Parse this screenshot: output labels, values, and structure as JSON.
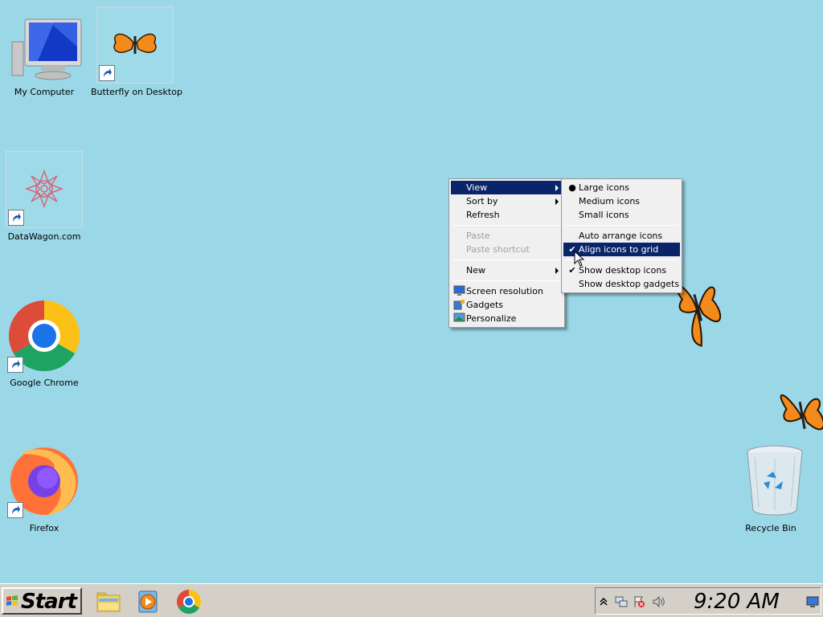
{
  "desktop": {
    "background": "#9ad8e8",
    "icons": [
      {
        "label": "My Computer",
        "icon": "monitor-icon",
        "shortcut": false
      },
      {
        "label": "Butterfly on Desktop",
        "icon": "butterfly-icon",
        "shortcut": true
      },
      {
        "label": "DataWagon.com",
        "icon": "datawagon-icon",
        "shortcut": true
      },
      {
        "label": "Google Chrome",
        "icon": "chrome-icon",
        "shortcut": true
      },
      {
        "label": "Firefox",
        "icon": "firefox-icon",
        "shortcut": true
      },
      {
        "label": "Recycle Bin",
        "icon": "recycle-bin-icon",
        "shortcut": false
      }
    ]
  },
  "context_menu": {
    "items": [
      {
        "label": "View",
        "highlighted": true,
        "submenu": true
      },
      {
        "label": "Sort by",
        "submenu": true
      },
      {
        "label": "Refresh"
      },
      {
        "label": "Paste",
        "disabled": true
      },
      {
        "label": "Paste shortcut",
        "disabled": true
      },
      {
        "label": "New",
        "submenu": true
      },
      {
        "label": "Screen resolution",
        "icon": "screen-resolution-icon"
      },
      {
        "label": "Gadgets",
        "icon": "gadgets-icon"
      },
      {
        "label": "Personalize",
        "icon": "personalize-icon"
      }
    ]
  },
  "view_submenu": {
    "items": [
      {
        "label": "Large icons",
        "mark": "bullet"
      },
      {
        "label": "Medium icons"
      },
      {
        "label": "Small icons"
      },
      {
        "label": "Auto arrange icons"
      },
      {
        "label": "Align icons to grid",
        "mark": "check",
        "highlighted": true
      },
      {
        "label": "Show desktop icons",
        "mark": "check"
      },
      {
        "label": "Show desktop gadgets"
      }
    ]
  },
  "taskbar": {
    "start_label": "Start",
    "pinned": [
      "file-explorer-icon",
      "media-player-icon",
      "chrome-icon"
    ],
    "tray_icons": [
      "chevron-up-icon",
      "network-icon",
      "action-center-icon",
      "volume-icon"
    ],
    "clock": "9:20 AM",
    "show_desktop": "show-desktop-icon"
  },
  "colors": {
    "menu_highlight": "#0a246a",
    "taskbar": "#d4d0c8",
    "butterfly": "#f28a1c"
  }
}
